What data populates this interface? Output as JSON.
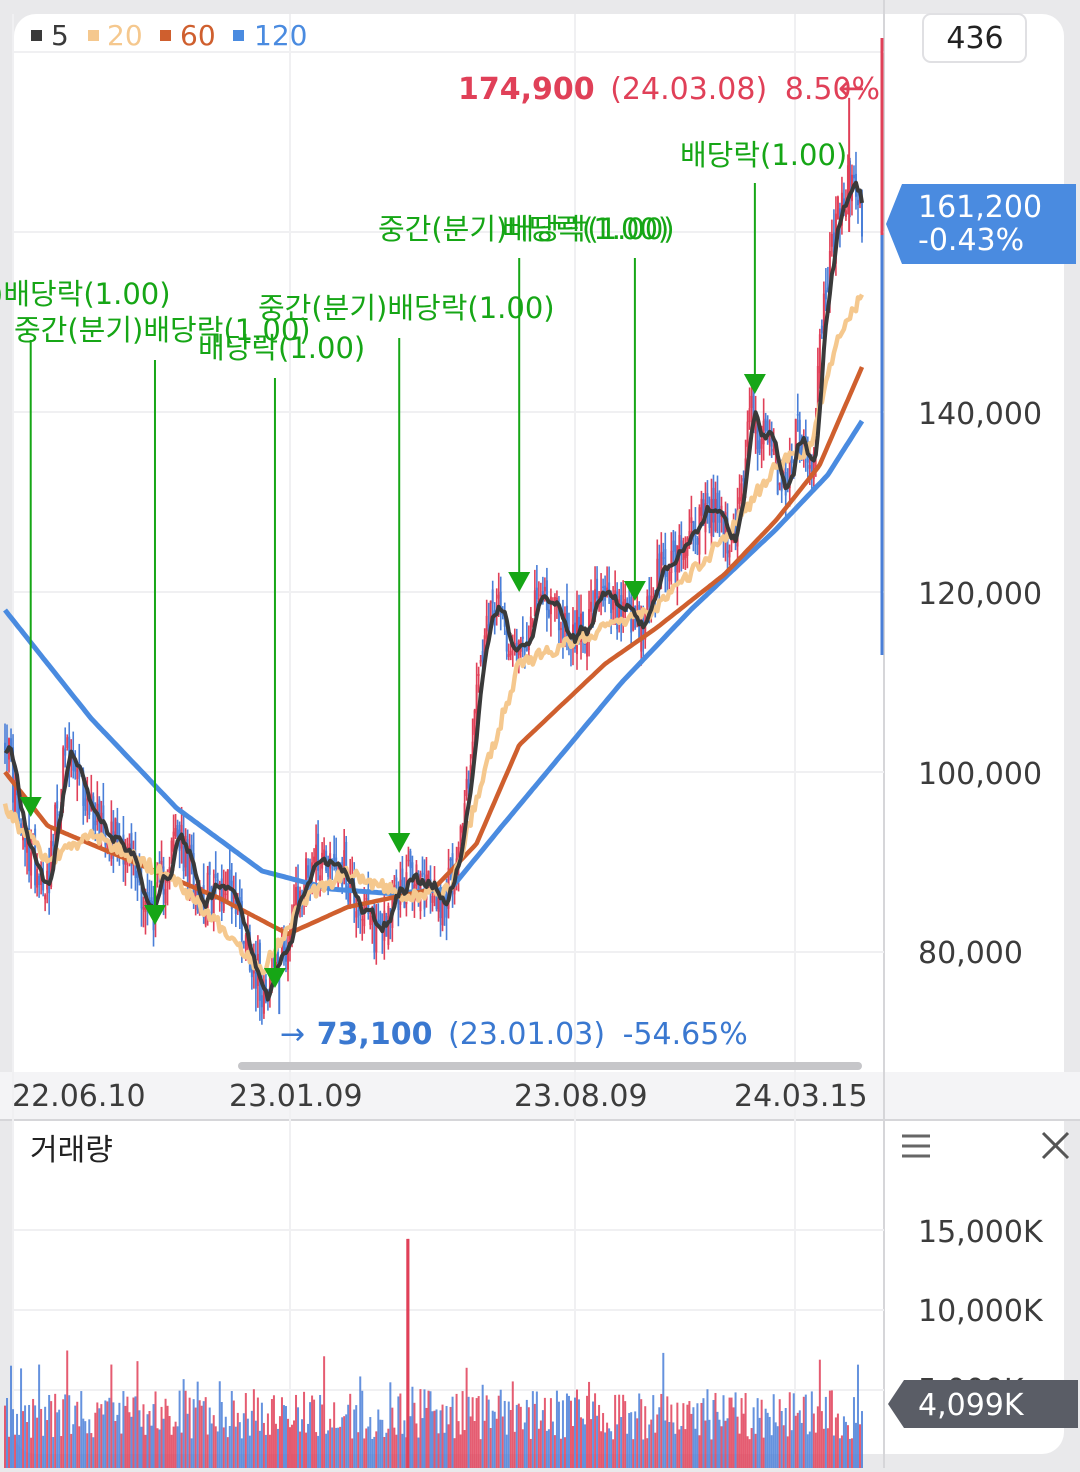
{
  "header": {
    "legend": [
      {
        "label": "5",
        "color": "#3a3a3a"
      },
      {
        "label": "20",
        "color": "#f5c88e"
      },
      {
        "label": "60",
        "color": "#cf5f2e"
      },
      {
        "label": "120",
        "color": "#4a8be0"
      }
    ],
    "count_badge": "436"
  },
  "price_panel": {
    "max_label": {
      "price": "174,900",
      "date": "(24.03.08)",
      "pct": "8.50%",
      "arrow": "←"
    },
    "min_label": {
      "arrow": "→",
      "price": "73,100",
      "date": "(23.01.03)",
      "pct": "-54.65%"
    },
    "current_price": {
      "price": "161,200",
      "change": "-0.43%"
    },
    "y_ticks": [
      "140,000",
      "120,000",
      "100,000",
      "80,000"
    ],
    "x_ticks": [
      "22.06.10",
      "23.01.09",
      "23.08.09",
      "24.03.15"
    ],
    "events": [
      {
        "label": ")배당락(1.00)"
      },
      {
        "label": "중간(분기)배당락(1.00)"
      },
      {
        "label": "배당락(1.00)"
      },
      {
        "label": "중간(분기)배당락(1.00)"
      },
      {
        "label": "중간(분기)배당락(1.00)"
      },
      {
        "label": "배당락(1.00)"
      },
      {
        "label": "배당락(1.00)"
      }
    ]
  },
  "volume_panel": {
    "title": "거래량",
    "y_ticks": [
      "15,000K",
      "10,000K",
      "5,000K"
    ],
    "current_volume": "4,099K",
    "menu_icon": "hamburger-menu-icon",
    "close_icon": "close-icon"
  },
  "colors": {
    "up": "#e04058",
    "down": "#4a7fd8",
    "event": "#16a616",
    "max": "#e04058",
    "min": "#3a78d0"
  },
  "chart_data": {
    "type": "line",
    "description": "Daily stock candlestick chart with 5/20/60/120-day moving averages and volume",
    "x_ticks": [
      "22.06.10",
      "23.01.09",
      "23.08.09",
      "24.03.15"
    ],
    "ylim": [
      65000,
      182000
    ],
    "close_anchors": [
      {
        "t": 0,
        "v": 105000
      },
      {
        "t": 0.02,
        "v": 92000
      },
      {
        "t": 0.05,
        "v": 88000
      },
      {
        "t": 0.07,
        "v": 102000
      },
      {
        "t": 0.1,
        "v": 96000
      },
      {
        "t": 0.14,
        "v": 92000
      },
      {
        "t": 0.17,
        "v": 84000
      },
      {
        "t": 0.2,
        "v": 93000
      },
      {
        "t": 0.23,
        "v": 86000
      },
      {
        "t": 0.26,
        "v": 88000
      },
      {
        "t": 0.3,
        "v": 76000
      },
      {
        "t": 0.32,
        "v": 79000
      },
      {
        "t": 0.36,
        "v": 91000
      },
      {
        "t": 0.39,
        "v": 90000
      },
      {
        "t": 0.43,
        "v": 82000
      },
      {
        "t": 0.47,
        "v": 88000
      },
      {
        "t": 0.515,
        "v": 86000
      },
      {
        "t": 0.535,
        "v": 95000
      },
      {
        "t": 0.555,
        "v": 112000
      },
      {
        "t": 0.57,
        "v": 118000
      },
      {
        "t": 0.6,
        "v": 114000
      },
      {
        "t": 0.63,
        "v": 120000
      },
      {
        "t": 0.66,
        "v": 115000
      },
      {
        "t": 0.7,
        "v": 119000
      },
      {
        "t": 0.74,
        "v": 115000
      },
      {
        "t": 0.76,
        "v": 121000
      },
      {
        "t": 0.8,
        "v": 127000
      },
      {
        "t": 0.83,
        "v": 129000
      },
      {
        "t": 0.85,
        "v": 125000
      },
      {
        "t": 0.87,
        "v": 140000
      },
      {
        "t": 0.89,
        "v": 136000
      },
      {
        "t": 0.91,
        "v": 131000
      },
      {
        "t": 0.925,
        "v": 138000
      },
      {
        "t": 0.94,
        "v": 133000
      },
      {
        "t": 0.955,
        "v": 152000
      },
      {
        "t": 0.97,
        "v": 161000
      },
      {
        "t": 0.985,
        "v": 166000
      },
      {
        "t": 1,
        "v": 161200
      }
    ],
    "ma_anchors": {
      "ma20": [
        {
          "t": 0,
          "v": 96000
        },
        {
          "t": 0.05,
          "v": 90000
        },
        {
          "t": 0.1,
          "v": 93000
        },
        {
          "t": 0.2,
          "v": 88000
        },
        {
          "t": 0.3,
          "v": 78000
        },
        {
          "t": 0.35,
          "v": 86000
        },
        {
          "t": 0.4,
          "v": 89000
        },
        {
          "t": 0.47,
          "v": 86000
        },
        {
          "t": 0.52,
          "v": 87000
        },
        {
          "t": 0.56,
          "v": 100000
        },
        {
          "t": 0.6,
          "v": 112000
        },
        {
          "t": 0.7,
          "v": 116000
        },
        {
          "t": 0.76,
          "v": 118000
        },
        {
          "t": 0.84,
          "v": 126000
        },
        {
          "t": 0.9,
          "v": 134000
        },
        {
          "t": 0.94,
          "v": 136000
        },
        {
          "t": 0.97,
          "v": 148000
        },
        {
          "t": 1,
          "v": 153000
        }
      ],
      "ma60": [
        {
          "t": 0,
          "v": 100000
        },
        {
          "t": 0.05,
          "v": 94000
        },
        {
          "t": 0.15,
          "v": 90000
        },
        {
          "t": 0.25,
          "v": 86000
        },
        {
          "t": 0.33,
          "v": 82000
        },
        {
          "t": 0.4,
          "v": 85000
        },
        {
          "t": 0.5,
          "v": 87000
        },
        {
          "t": 0.55,
          "v": 92000
        },
        {
          "t": 0.6,
          "v": 103000
        },
        {
          "t": 0.7,
          "v": 112000
        },
        {
          "t": 0.76,
          "v": 116000
        },
        {
          "t": 0.84,
          "v": 122000
        },
        {
          "t": 0.9,
          "v": 128000
        },
        {
          "t": 0.95,
          "v": 134000
        },
        {
          "t": 1,
          "v": 145000
        }
      ],
      "ma120": [
        {
          "t": 0,
          "v": 118000
        },
        {
          "t": 0.1,
          "v": 106000
        },
        {
          "t": 0.2,
          "v": 96000
        },
        {
          "t": 0.3,
          "v": 89000
        },
        {
          "t": 0.38,
          "v": 87000
        },
        {
          "t": 0.45,
          "v": 86500
        },
        {
          "t": 0.52,
          "v": 87000
        },
        {
          "t": 0.58,
          "v": 94000
        },
        {
          "t": 0.65,
          "v": 102000
        },
        {
          "t": 0.72,
          "v": 110000
        },
        {
          "t": 0.8,
          "v": 118000
        },
        {
          "t": 0.9,
          "v": 127000
        },
        {
          "t": 0.96,
          "v": 133000
        },
        {
          "t": 1,
          "v": 139000
        }
      ]
    },
    "max": {
      "value": 174900,
      "date": "24.03.08"
    },
    "min": {
      "value": 73100,
      "date": "23.01.03"
    },
    "event_points": [
      {
        "t": 0.03,
        "v": 95000
      },
      {
        "t": 0.175,
        "v": 83000
      },
      {
        "t": 0.315,
        "v": 76000
      },
      {
        "t": 0.46,
        "v": 91000
      },
      {
        "t": 0.6,
        "v": 120000
      },
      {
        "t": 0.735,
        "v": 119000
      },
      {
        "t": 0.875,
        "v": 142000
      }
    ],
    "volume": {
      "ylim": [
        0,
        18000
      ],
      "last": 4099,
      "spike": {
        "t": 0.47,
        "v": 14500
      }
    }
  }
}
